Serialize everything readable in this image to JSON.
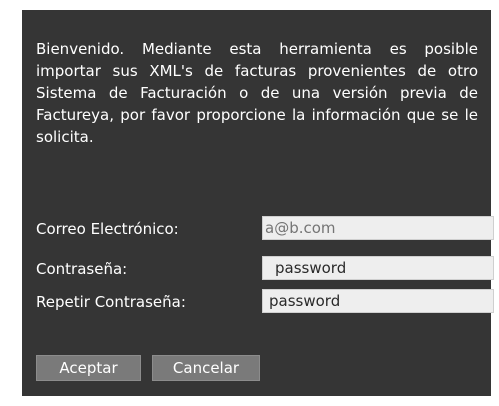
{
  "intro_text": "Bienvenido. Mediante esta herramienta es posible importar sus XML's de facturas provenientes de otro Sistema de Facturación o de una versión previa de Factureya, por favor proporcione la información que se le solicita.",
  "form": {
    "email": {
      "label": "Correo Electrónico:",
      "placeholder": "a@b.com",
      "value": ""
    },
    "password": {
      "label": "Contraseña:",
      "value": "password"
    },
    "repeat_password": {
      "label": "Repetir Contraseña:",
      "value": "password"
    }
  },
  "buttons": {
    "accept_label": "Aceptar",
    "cancel_label": "Cancelar"
  },
  "colors": {
    "panel_background": "#353535",
    "text": "#ffffff",
    "input_background": "#eeeeee",
    "button_background": "#7a7a7a"
  }
}
